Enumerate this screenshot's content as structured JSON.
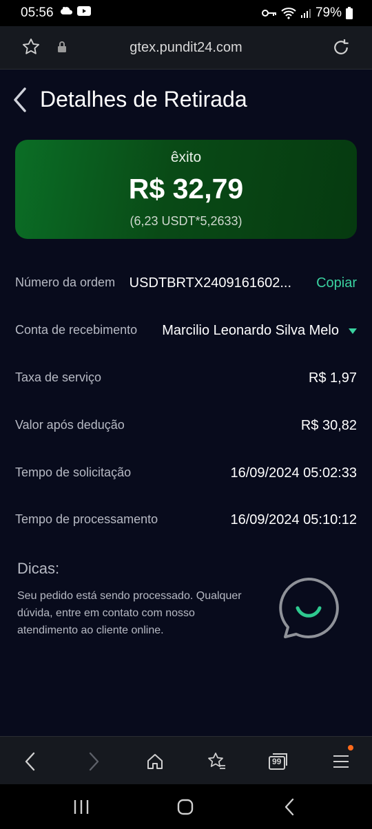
{
  "status_bar": {
    "time": "05:56",
    "battery": "79%"
  },
  "browser": {
    "url": "gtex.pundit24.com"
  },
  "page": {
    "title": "Detalhes de Retirada",
    "summary": {
      "status": "êxito",
      "amount": "R$ 32,79",
      "conversion": "(6,23 USDT*5,2633)"
    },
    "details": [
      {
        "label": "Número da ordem",
        "value": "USDTBRTX2409161602...",
        "action": "Copiar"
      },
      {
        "label": "Conta de recebimento",
        "value": "Marcilio Leonardo Silva Melo"
      },
      {
        "label": "Taxa de serviço",
        "value": "R$ 1,97"
      },
      {
        "label": "Valor após dedução",
        "value": "R$ 30,82"
      },
      {
        "label": "Tempo de solicitação",
        "value": "16/09/2024 05:02:33"
      },
      {
        "label": "Tempo de processamento",
        "value": "16/09/2024 05:10:12"
      }
    ],
    "tips": {
      "title": "Dicas:",
      "text": "Seu pedido está sendo processado. Qualquer dúvida, entre em contato com nosso atendimento ao cliente online."
    }
  },
  "bottom_nav": {
    "tabs_count": "99"
  },
  "colors": {
    "accent": "#3ad2a0",
    "card_green": "#0b6e26",
    "background": "#080b1c",
    "notification_dot": "#ff6a1a"
  },
  "icons": [
    "cloud-icon",
    "youtube-icon",
    "key-icon",
    "wifi-icon",
    "signal-icon",
    "battery-icon",
    "star-icon",
    "lock-icon",
    "reload-icon",
    "back-arrow-icon",
    "dropdown-triangle-icon",
    "chat-support-icon",
    "nav-back-icon",
    "nav-forward-icon",
    "home-icon",
    "bookmarks-icon",
    "tabs-icon",
    "menu-icon",
    "recents-icon",
    "home-circle-icon",
    "system-back-icon"
  ]
}
